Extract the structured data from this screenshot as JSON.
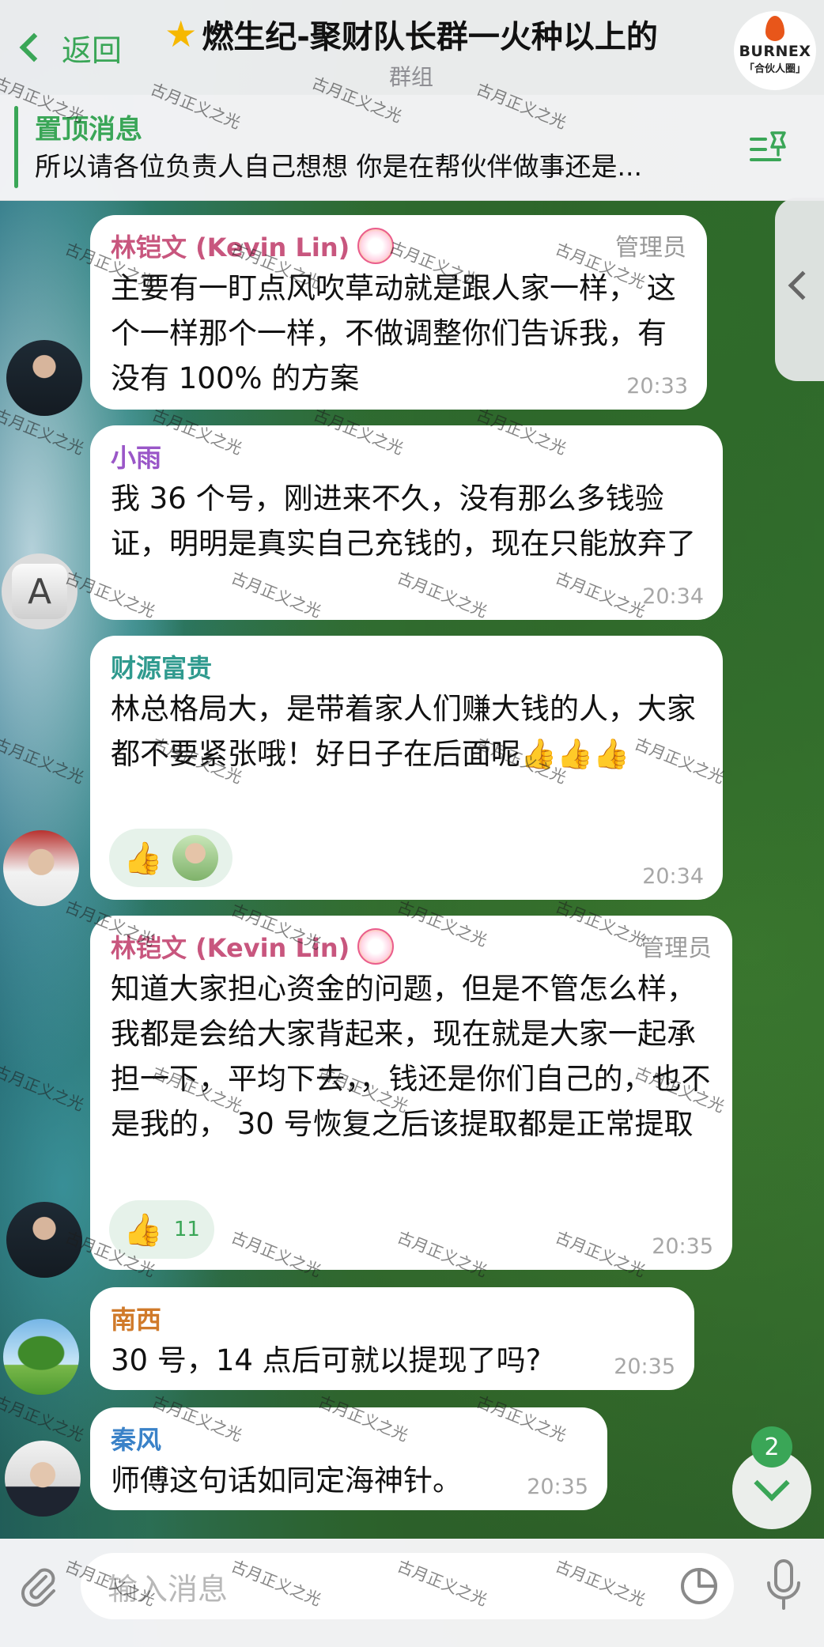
{
  "header": {
    "back_label": "返回",
    "title": "燃生纪-聚财队长群一火种以上的",
    "subtitle": "群组",
    "logo_brand": "BURNEX",
    "logo_sub": "「合伙人圈」"
  },
  "pinned": {
    "title": "置顶消息",
    "text": "所以请各位负责人自己想想 你是在帮伙伴做事还是..."
  },
  "messages": [
    {
      "sender": "林铠文 (Kevin Lin)",
      "role": "管理员",
      "text": "主要有一盯点风吹草动就是跟人家一样，  这个一样那个一样，不做调整你们告诉我，有没有 100% 的方案",
      "time": "20:33",
      "name_color": "#c8567e"
    },
    {
      "sender": "小雨",
      "text": "我 36 个号，刚进来不久，没有那么多钱验证，明明是真实自己充钱的，现在只能放弃了",
      "time": "20:34",
      "name_color": "#9a57c8"
    },
    {
      "sender": "财源富贵",
      "text": "林总格局大，是带着家人们赚大钱的人，大家都不要紧张哦！好日子在后面呢👍👍👍",
      "time": "20:34",
      "reaction": "👍",
      "name_color": "#2f9a8e"
    },
    {
      "sender": "林铠文 (Kevin Lin)",
      "role": "管理员",
      "text": "知道大家担心资金的问题，但是不管怎么样，我都是会给大家背起来，现在就是大家一起承担一下，平均下去，，钱还是你们自己的，也不是我的，  30 号恢复之后该提取都是正常提取",
      "time": "20:35",
      "reaction": "👍",
      "reaction_count": "11",
      "name_color": "#c8567e"
    },
    {
      "sender": "南西",
      "text": "30 号，14 点后可就以提现了吗?",
      "time": "20:35",
      "name_color": "#d07a2a"
    },
    {
      "sender": "秦风",
      "text": "师傅这句话如同定海神针。",
      "time": "20:35",
      "name_color": "#3a82c8"
    }
  ],
  "scroll": {
    "unread_count": "2"
  },
  "input": {
    "placeholder": "输入消息"
  },
  "watermark_text": "古月正义之光",
  "colors": {
    "accent": "#3aa657"
  },
  "icons": [
    "back-chevron-icon",
    "pin-list-icon",
    "attach-icon",
    "sticker-icon",
    "microphone-icon",
    "scroll-down-icon"
  ]
}
